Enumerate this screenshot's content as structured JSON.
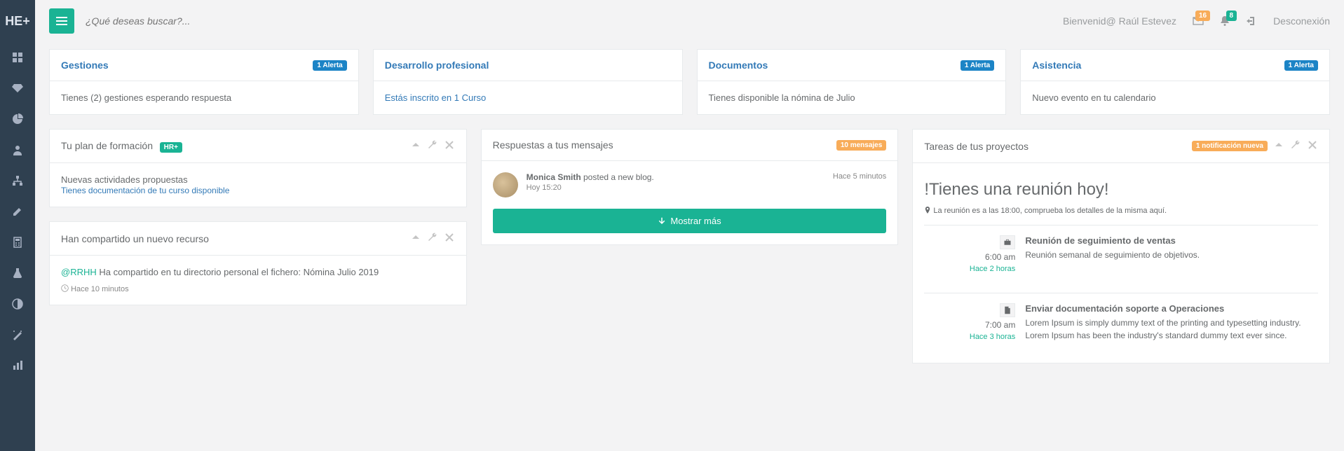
{
  "brand": "HE+",
  "search": {
    "placeholder": "¿Qué deseas buscar?..."
  },
  "topbar": {
    "welcome_prefix": "Bienvenid@",
    "user": "Raúl Estevez",
    "mail_badge": "16",
    "bell_badge": "8",
    "logout": "Desconexión"
  },
  "cards": {
    "gestiones": {
      "title": "Gestiones",
      "alert": "1 Alerta",
      "body": "Tienes (2) gestiones esperando respuesta"
    },
    "desarrollo": {
      "title": "Desarrollo profesional",
      "body": "Estás inscrito en 1 Curso"
    },
    "documentos": {
      "title": "Documentos",
      "alert": "1 Alerta",
      "body": "Tienes disponible la nómina de Julio"
    },
    "asistencia": {
      "title": "Asistencia",
      "alert": "1 Alerta",
      "body": "Nuevo evento en tu calendario"
    }
  },
  "plan": {
    "title": "Tu plan de formación",
    "badge": "HR+",
    "line1": "Nuevas actividades propuestas",
    "line2": "Tienes documentación de tu curso disponible"
  },
  "share": {
    "title": "Han compartido un nuevo recurso",
    "mention": "@RRHH",
    "body": " Ha compartido en tu directorio personal el fichero: Nómina Julio 2019",
    "time": "Hace 10 minutos"
  },
  "messages": {
    "title": "Respuestas a tus mensajes",
    "badge": "10 mensajes",
    "author": "Monica Smith",
    "action": " posted a new blog.",
    "sub": "Hoy 15:20",
    "right": "Hace 5 minutos",
    "button": "Mostrar más"
  },
  "tasks": {
    "title": "Tareas de tus proyectos",
    "badge": "1 notificación nueva",
    "hero_title": "!Tienes una reunión hoy!",
    "hero_sub": "La reunión es a las 18:00, comprueba los detalles de la misma aquí.",
    "items": [
      {
        "hour": "6:00 am",
        "ago": "Hace 2 horas",
        "title": "Reunión de seguimiento de ventas",
        "desc": "Reunión semanal de seguimiento de objetivos."
      },
      {
        "hour": "7:00 am",
        "ago": "Hace 3 horas",
        "title": "Enviar documentación soporte a Operaciones",
        "desc": "Lorem Ipsum is simply dummy text of the printing and typesetting industry. Lorem Ipsum has been the industry's standard dummy text ever since."
      }
    ]
  }
}
